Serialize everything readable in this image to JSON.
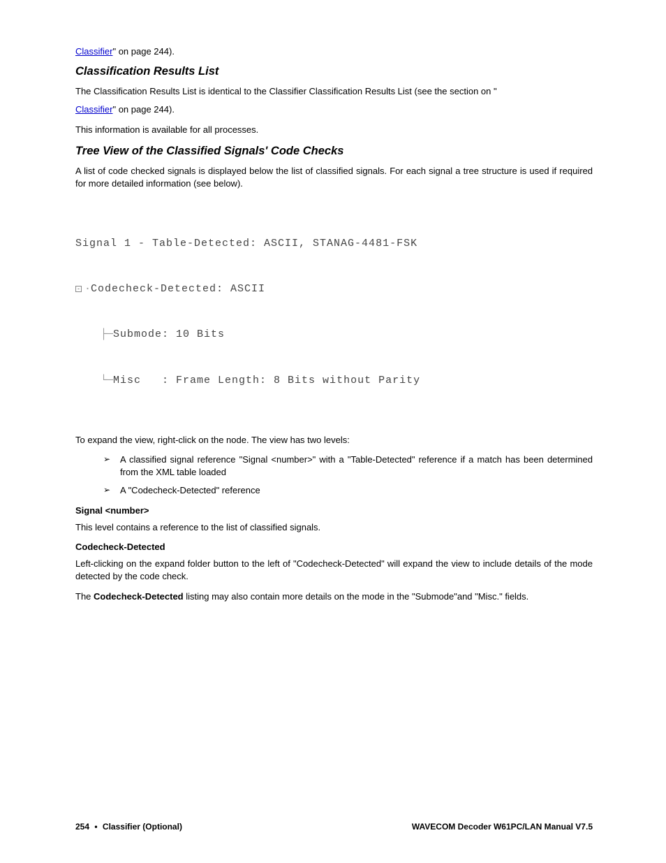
{
  "top": {
    "link1": "Classifier",
    "link1_suffix": "\" on page 244)."
  },
  "section1": {
    "heading": "Classification Results List",
    "para1": "The Classification Results List is identical to the Classifier Classification Results List (see the section on \"",
    "link": "Classifier",
    "link_suffix": "\" on page 244).",
    "para2": "This information is available for all processes."
  },
  "section2": {
    "heading": "Tree View of the Classified Signals' Code Checks",
    "para1": "A list of code checked signals is displayed below the list of classified signals.  For each signal a tree structure is used if required for more detailed information (see below)."
  },
  "tree": {
    "line1": "Signal 1 - Table-Detected: ASCII, STANAG-4481-FSK",
    "line2": "Codecheck-Detected: ASCII",
    "line3": "Submode: 10 Bits",
    "line4": "Misc   : Frame Length: 8 Bits without Parity"
  },
  "after_tree": {
    "para1": "To expand the view, right-click on the node. The view has two levels:",
    "bullet1": "A classified signal reference \"Signal <number>\" with a \"Table-Detected\" reference if a match has been determined from the XML table loaded",
    "bullet2": "A \"Codecheck-Detected\" reference"
  },
  "sub1": {
    "heading": "Signal <number>",
    "para": "This level contains a reference to the list of classified signals."
  },
  "sub2": {
    "heading": "Codecheck-Detected",
    "para1": "Left-clicking on the expand folder button to the left of \"Codecheck-Detected\" will expand the view to include details of the mode detected by the code check.",
    "para2_a": "The ",
    "para2_b": "Codecheck-Detected",
    "para2_c": " listing may also contain more details on the mode in the \"Submode\"and \"Misc.\" fields."
  },
  "footer": {
    "page_num": "254",
    "dot": "•",
    "section": "Classifier (Optional)",
    "right": "WAVECOM Decoder W61PC/LAN Manual V7.5"
  }
}
